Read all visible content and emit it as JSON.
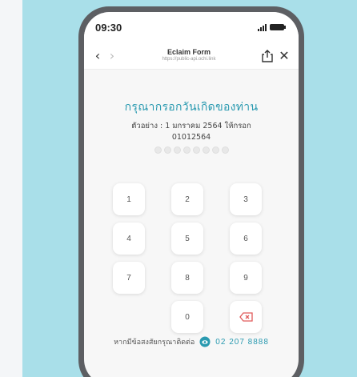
{
  "status_bar": {
    "time": "09:30"
  },
  "browser": {
    "title": "Eclaim Form",
    "url": "https://public-api.ochi.link"
  },
  "prompt": {
    "title": "กรุณากรอกวันเกิดของท่าน",
    "example_line1": "ตัวอย่าง : 1 มกราคม 2564 ให้กรอก",
    "example_line2": "01012564",
    "pin_length": 8
  },
  "keypad": {
    "keys": [
      "1",
      "2",
      "3",
      "4",
      "5",
      "6",
      "7",
      "8",
      "9",
      "",
      "0",
      "backspace"
    ]
  },
  "footer": {
    "text": "หากมีข้อสงสัยกรุณาติดต่อ",
    "phone": "02 207 8888"
  },
  "colors": {
    "accent": "#2a9ab0",
    "background": "#a9dfe9",
    "backspace": "#e05a5a"
  }
}
